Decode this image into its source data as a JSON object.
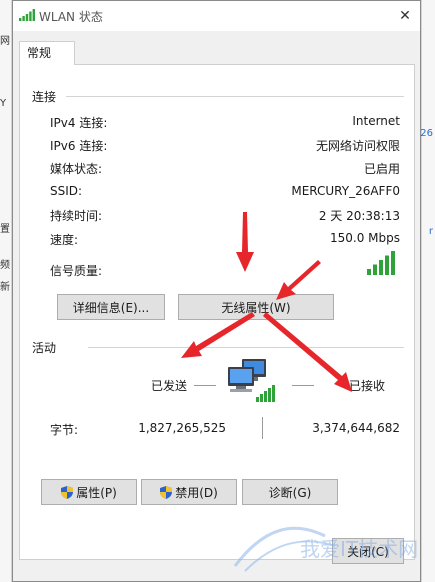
{
  "window": {
    "title": "WLAN 状态",
    "close_glyph": "✕"
  },
  "tabs": [
    {
      "label": "常规"
    }
  ],
  "connection": {
    "group_label": "连接",
    "rows": [
      {
        "label": "IPv4 连接:",
        "value": "Internet"
      },
      {
        "label": "IPv6 连接:",
        "value": "无网络访问权限"
      },
      {
        "label": "媒体状态:",
        "value": "已启用"
      },
      {
        "label": "SSID:",
        "value": "MERCURY_26AFF0"
      },
      {
        "label": "持续时间:",
        "value": "2 天 20:38:13"
      },
      {
        "label": "速度:",
        "value": "150.0 Mbps"
      }
    ],
    "signal_label": "信号质量:",
    "signal_bars_lit": 5,
    "signal_bars_total": 5,
    "details_button": "详细信息(E)...",
    "wireless_button": "无线属性(W)"
  },
  "activity": {
    "group_label": "活动",
    "sent_label": "已发送",
    "received_label": "已接收",
    "bytes_label": "字节:",
    "bytes_sent": "1,827,265,525",
    "bytes_received": "3,374,644,682"
  },
  "buttons": {
    "properties": "属性(P)",
    "disable": "禁用(D)",
    "diagnose": "诊断(G)"
  },
  "footer": {
    "close_button": "关闭(C)"
  },
  "background": {
    "left_fragments": [
      "网",
      "Y",
      "置",
      "新",
      "频"
    ],
    "right_fragments": [
      "26",
      "r"
    ]
  },
  "colors": {
    "accent": "#2a6bd2",
    "arrow": "#e6262b",
    "signal": "#2fa33a"
  }
}
